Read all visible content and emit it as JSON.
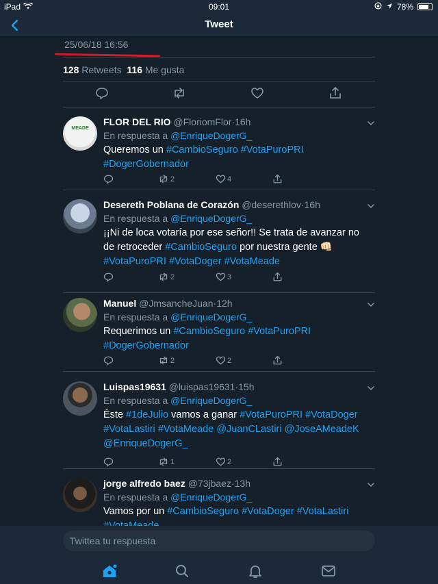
{
  "status_bar": {
    "device": "iPad",
    "time": "09:01",
    "battery": "78%",
    "battery_level": 0.78
  },
  "navbar": {
    "title": "Tweet"
  },
  "main_tweet": {
    "timestamp": "25/06/18 16:56",
    "retweets_count": "128",
    "retweets_label": "Retweets",
    "likes_count": "116",
    "likes_label": "Me gusta"
  },
  "replies": [
    {
      "name": "FLOR DEL RIO",
      "handle": "@FloriomFlor",
      "time": "16h",
      "reply_prefix": "En respuesta a",
      "reply_to": "@EnriqueDogerG_",
      "text_segments": [
        {
          "t": "Queremos un ",
          "h": false
        },
        {
          "t": "#CambioSeguro",
          "h": true
        },
        {
          "t": " ",
          "h": false
        },
        {
          "t": "#VotaPuroPRI",
          "h": true
        },
        {
          "t": " ",
          "h": false
        },
        {
          "t": "#DogerGobernador",
          "h": true
        }
      ],
      "retweets": "2",
      "likes": "4",
      "avatar_text": "MEADE"
    },
    {
      "name": "Desereth Poblana de Corazón",
      "handle": "@deserethlov",
      "time": "16h",
      "reply_prefix": "En respuesta a",
      "reply_to": "@EnriqueDogerG_",
      "text_segments": [
        {
          "t": "¡¡Ni de loca votaría por ese señor!! Se trata de avanzar no de retroceder ",
          "h": false
        },
        {
          "t": "#CambioSeguro",
          "h": true
        },
        {
          "t": " por nuestra gente 👊🏻 ",
          "h": false
        },
        {
          "t": "#VotaPuroPRI",
          "h": true
        },
        {
          "t": " ",
          "h": false
        },
        {
          "t": "#VotaDoger",
          "h": true
        },
        {
          "t": " ",
          "h": false
        },
        {
          "t": "#VotaMeade",
          "h": true
        }
      ],
      "retweets": "2",
      "likes": "3",
      "avatar_text": ""
    },
    {
      "name": "Manuel",
      "handle": "@JmsancheJuan",
      "time": "12h",
      "reply_prefix": "En respuesta a",
      "reply_to": "@EnriqueDogerG_",
      "text_segments": [
        {
          "t": "Requerimos un ",
          "h": false
        },
        {
          "t": "#CambioSeguro",
          "h": true
        },
        {
          "t": " ",
          "h": false
        },
        {
          "t": "#VotaPuroPRI",
          "h": true
        },
        {
          "t": " ",
          "h": false
        },
        {
          "t": "#DogerGobernador",
          "h": true
        }
      ],
      "retweets": "2",
      "likes": "2",
      "avatar_text": ""
    },
    {
      "name": "Luispas19631",
      "handle": "@luispas19631",
      "time": "15h",
      "reply_prefix": "En respuesta a",
      "reply_to": "@EnriqueDogerG_",
      "text_segments": [
        {
          "t": "Éste ",
          "h": false
        },
        {
          "t": "#1deJulio",
          "h": true
        },
        {
          "t": " vamos a ganar ",
          "h": false
        },
        {
          "t": "#VotaPuroPRI",
          "h": true
        },
        {
          "t": " ",
          "h": false
        },
        {
          "t": "#VotaDoger",
          "h": true
        },
        {
          "t": " ",
          "h": false
        },
        {
          "t": "#VotaLastiri",
          "h": true
        },
        {
          "t": " ",
          "h": false
        },
        {
          "t": "#VotaMeade",
          "h": true
        },
        {
          "t": " ",
          "h": false
        },
        {
          "t": "@JuanCLastiri",
          "h": true
        },
        {
          "t": " ",
          "h": false
        },
        {
          "t": "@JoseAMeadeK",
          "h": true
        },
        {
          "t": " ",
          "h": false
        },
        {
          "t": "@EnriqueDogerG_",
          "h": true
        }
      ],
      "retweets": "1",
      "likes": "2",
      "avatar_text": ""
    },
    {
      "name": "jorge alfredo baez",
      "handle": "@73jbaez",
      "time": "13h",
      "reply_prefix": "En respuesta a",
      "reply_to": "@EnriqueDogerG_",
      "text_segments": [
        {
          "t": "Vamos por un ",
          "h": false
        },
        {
          "t": "#CambioSeguro",
          "h": true
        },
        {
          "t": " ",
          "h": false
        },
        {
          "t": "#VotaDoger",
          "h": true
        },
        {
          "t": " ",
          "h": false
        },
        {
          "t": "#VotaLastiri",
          "h": true
        },
        {
          "t": " ",
          "h": false
        },
        {
          "t": "#VotaMeade",
          "h": true
        }
      ],
      "retweets": "",
      "likes": "",
      "avatar_text": ""
    }
  ],
  "reply_bar": {
    "placeholder": "Twittea tu respuesta"
  },
  "colors": {
    "background": "#15202b",
    "accent": "#1da1f2",
    "secondary_text": "#8899a6",
    "annotation_red": "#d01c2a"
  },
  "icons": [
    "back-icon",
    "reply-icon",
    "retweet-icon",
    "like-icon",
    "share-icon",
    "chevron-down-icon",
    "home-icon",
    "search-icon",
    "notifications-icon",
    "messages-icon"
  ]
}
